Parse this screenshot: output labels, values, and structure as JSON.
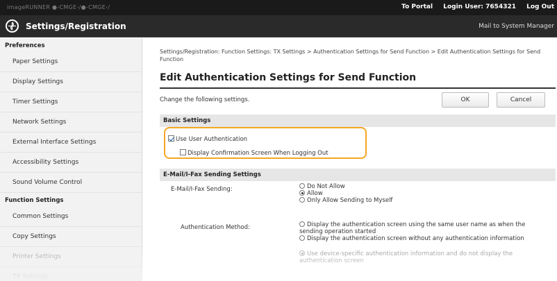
{
  "topbar": {
    "device_name": "imageRUNNER   ●-CMGE-/●-CMGE-/",
    "to_portal": "To Portal",
    "login_user": "Login User:  7654321",
    "logout": "Log Out"
  },
  "header": {
    "title": "Settings/Registration",
    "mail_link": "Mail to System Manager"
  },
  "sidebar": {
    "groups": [
      {
        "label": "Preferences",
        "items": [
          "Paper Settings",
          "Display Settings",
          "Timer Settings",
          "Network Settings",
          "External Interface Settings",
          "Accessibility Settings",
          "Sound Volume Control"
        ]
      },
      {
        "label": "Function Settings",
        "items": [
          "Common Settings",
          "Copy Settings",
          "Printer Settings",
          "TX Settings"
        ]
      }
    ]
  },
  "main": {
    "breadcrumb": "Settings/Registration: Function Settings: TX Settings > Authentication Settings for Send Function > Edit Authentication Settings for Send Function",
    "page_title": "Edit Authentication Settings for Send Function",
    "change_text": "Change the following settings.",
    "ok_label": "OK",
    "cancel_label": "Cancel",
    "basic_settings": {
      "header": "Basic Settings",
      "use_user_auth": {
        "label": "Use User Authentication",
        "checked": true
      },
      "display_confirm": {
        "label": "Display Confirmation Screen When Logging Out",
        "checked": false
      }
    },
    "email_ifax": {
      "header": "E-Mail/I-Fax Sending Settings",
      "sending_label": "E-Mail/I-Fax Sending:",
      "sending_options": [
        {
          "label": "Do Not Allow",
          "selected": false
        },
        {
          "label": "Allow",
          "selected": true
        },
        {
          "label": "Only Allow Sending to Myself",
          "selected": false
        }
      ],
      "auth_method_label": "Authentication Method:",
      "auth_options": [
        {
          "label": "Display the authentication screen using the same user name as when the sending operation started",
          "selected": false
        },
        {
          "label": "Display the authentication screen without any authentication information",
          "selected": false
        },
        {
          "label": "Use device-specific authentication information and do not display the authentication screen",
          "selected": true
        }
      ]
    }
  },
  "colors": {
    "topbar_bg": "#1a1a1a",
    "header_bg": "#2a2a2a",
    "sidebar_bg": "#f2f2f2",
    "section_bg": "#e6e6e6",
    "highlight": "#f5a623"
  }
}
